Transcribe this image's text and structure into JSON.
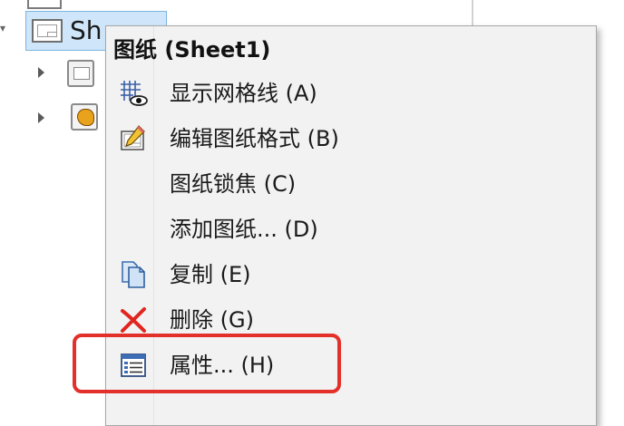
{
  "tree": {
    "sheet_label": "Sh",
    "caret": "▾"
  },
  "menu": {
    "title": "图纸 (Sheet1)",
    "items": [
      {
        "label": "显示网格线 (A)",
        "icon": "grid-eye-icon"
      },
      {
        "label": "编辑图纸格式 (B)",
        "icon": "edit-sheet-format-icon"
      },
      {
        "label": "图纸锁焦 (C)",
        "icon": ""
      },
      {
        "label": "添加图纸... (D)",
        "icon": ""
      },
      {
        "label": "复制 (E)",
        "icon": "copy-icon"
      },
      {
        "label": "删除 (G)",
        "icon": "delete-icon"
      },
      {
        "label": "属性... (H)",
        "icon": "properties-icon"
      }
    ]
  },
  "colors": {
    "selection_bg": "#cfe6fa",
    "highlight": "#e3302b",
    "delete_red": "#e0261f"
  }
}
